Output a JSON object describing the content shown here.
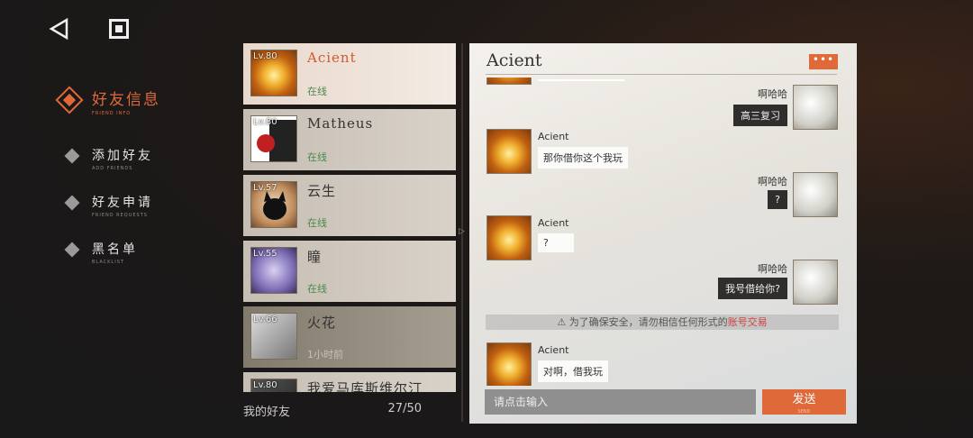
{
  "nav": {
    "back_icon": "back-triangle-icon",
    "home_icon": "square-home-icon"
  },
  "menu": [
    {
      "zh": "好友信息",
      "en": "FRIEND INFO",
      "active": true
    },
    {
      "zh": "添加好友",
      "en": "ADD FRIENDS",
      "active": false
    },
    {
      "zh": "好友申请",
      "en": "FRIEND REQUESTS",
      "active": false
    },
    {
      "zh": "黑名单",
      "en": "BLACKLIST",
      "active": false
    }
  ],
  "friends": [
    {
      "level": "Lv.80",
      "name": "Acient",
      "status": "在线"
    },
    {
      "level": "Lv.80",
      "name": "Matheus",
      "status": "在线"
    },
    {
      "level": "Lv.57",
      "name": "云生",
      "status": "在线"
    },
    {
      "level": "Lv.55",
      "name": "瞳",
      "status": "在线"
    },
    {
      "level": "Lv.66",
      "name": "火花",
      "status": "1小时前"
    },
    {
      "level": "Lv.80",
      "name": "我爱马库斯维尔汀",
      "status": ""
    }
  ],
  "friend_footer": {
    "label": "我的好友",
    "count": "27/50"
  },
  "chat": {
    "title": "Acient",
    "more_label": "•••",
    "messages": [
      {
        "side": "right",
        "name": "啊哈哈",
        "text": "高三复习"
      },
      {
        "side": "left",
        "name": "Acient",
        "text": "那你借你这个我玩"
      },
      {
        "side": "right",
        "name": "啊哈哈",
        "text": "?"
      },
      {
        "side": "left",
        "name": "Acient",
        "text": "?"
      },
      {
        "side": "right",
        "name": "啊哈哈",
        "text": "我号借给你?"
      },
      {
        "side": "left",
        "name": "Acient",
        "text": "对啊，借我玩"
      }
    ],
    "notice_prefix": "为了确保安全，请勿相信任何形式的",
    "notice_highlight": "账号交易",
    "input_placeholder": "请点击输入",
    "send_label": "发送",
    "send_label_en": "SEND"
  },
  "colors": {
    "accent": "#e0693a",
    "online": "#4a8a4a",
    "notice_warn": "#d04040"
  }
}
